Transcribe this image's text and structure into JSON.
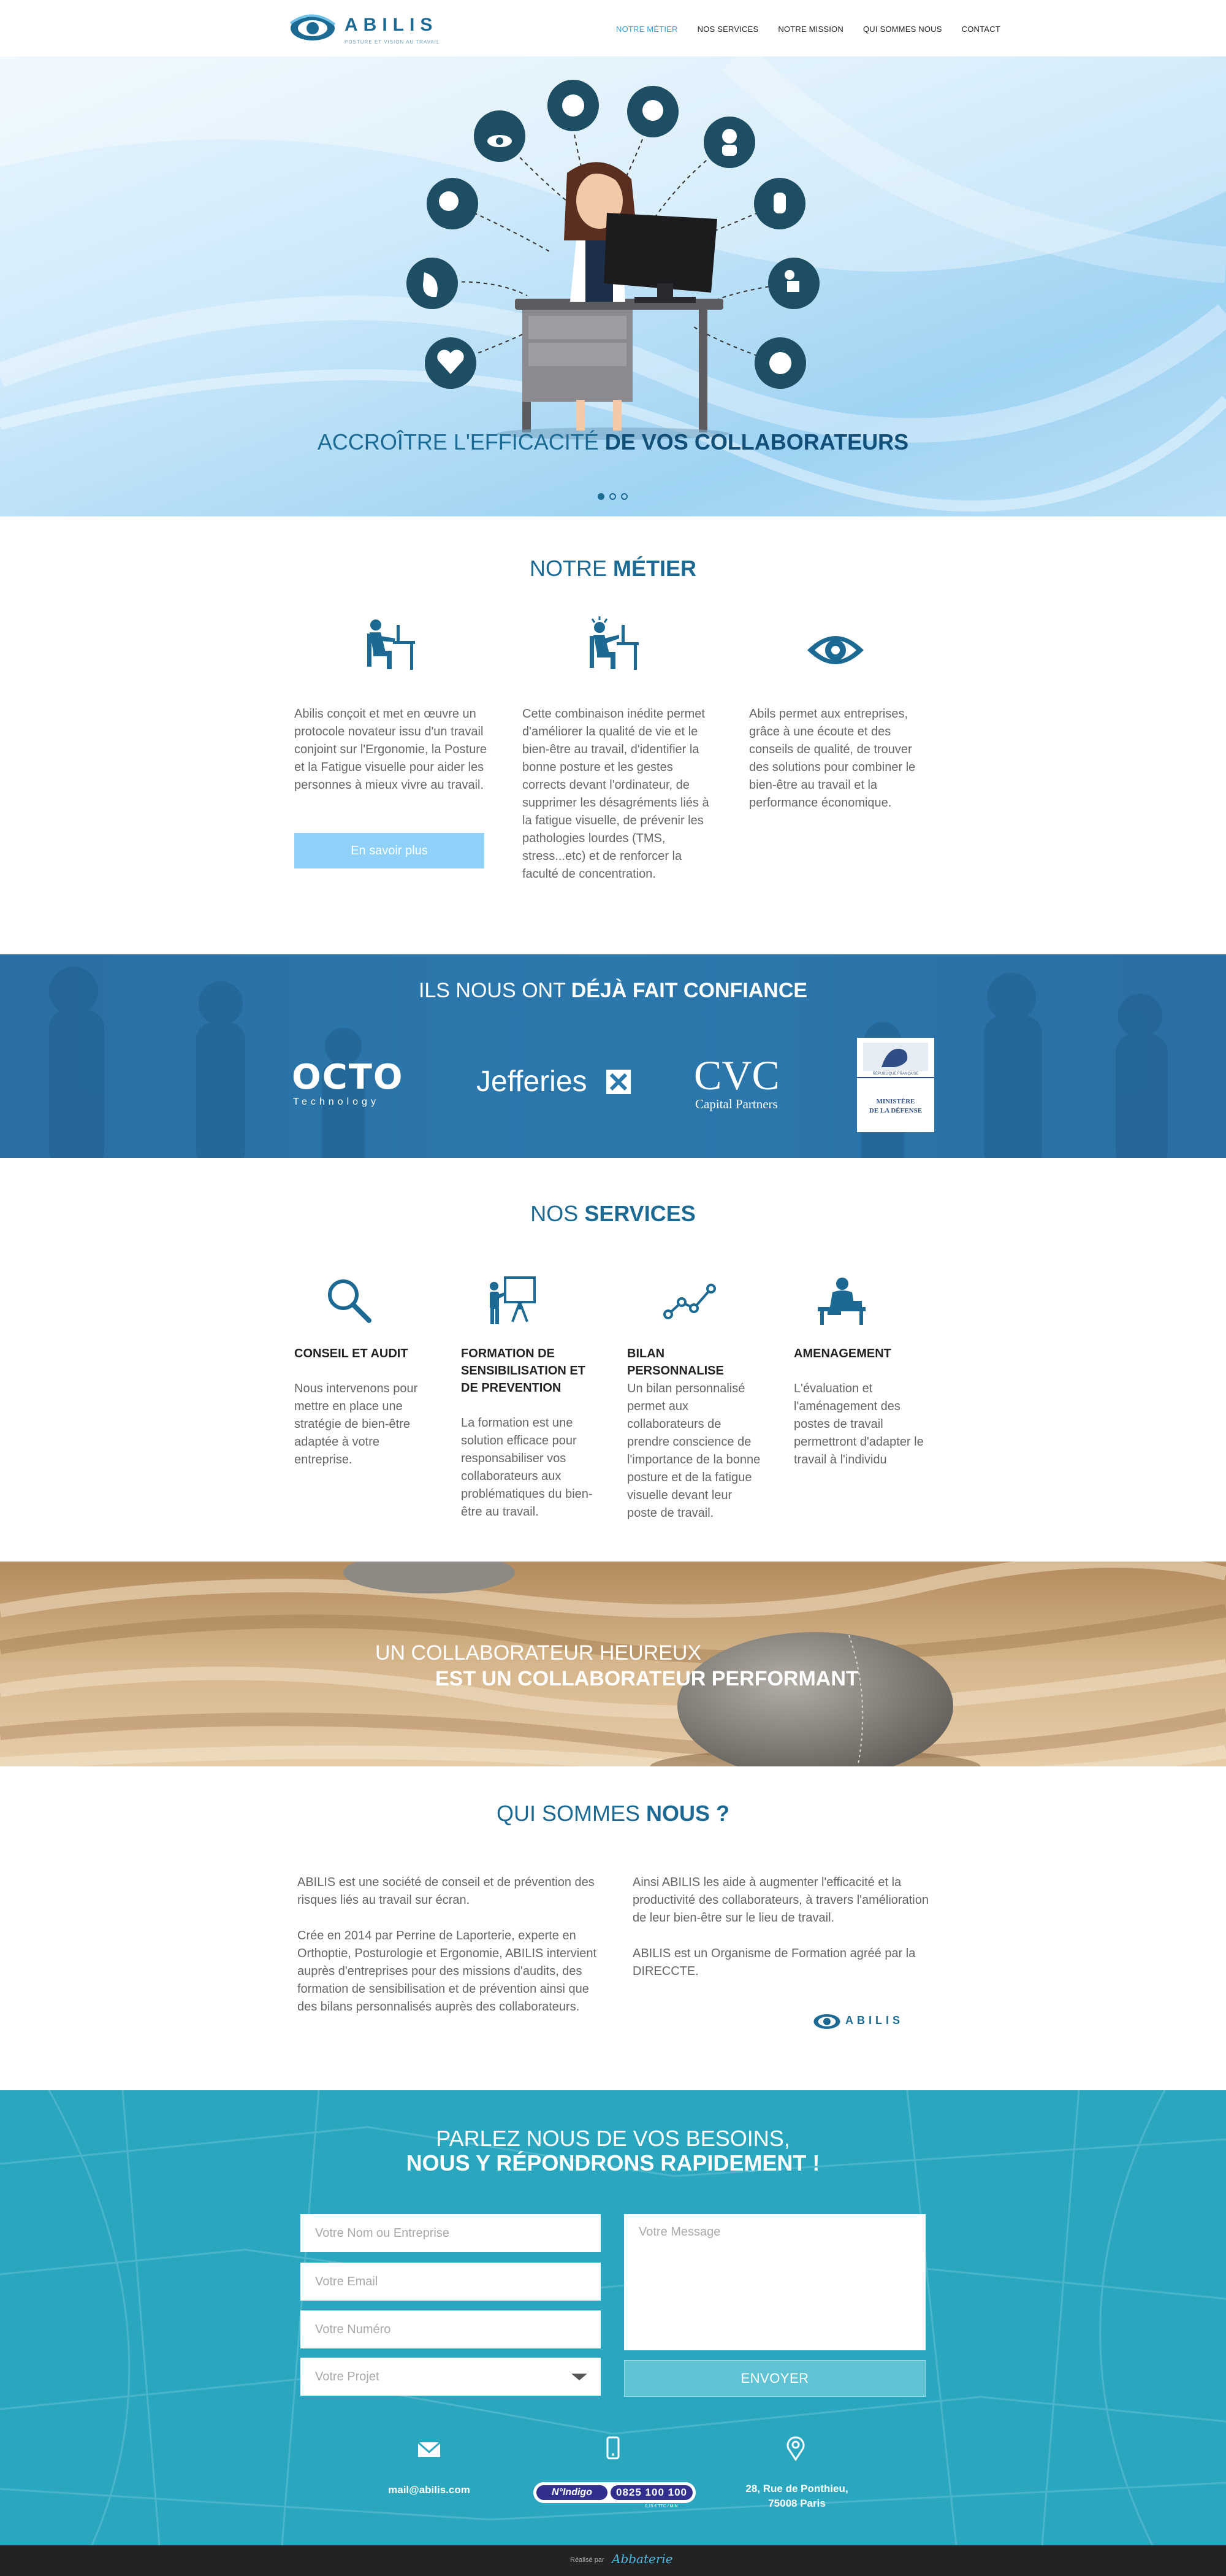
{
  "header": {
    "logo_text": "ABILIS",
    "logo_tagline": "POSTURE ET VISION AU TRAVAIL",
    "nav": [
      {
        "label": "NOTRE MÉTIER",
        "active": true
      },
      {
        "label": "NOS SERVICES",
        "active": false
      },
      {
        "label": "NOTRE MISSION",
        "active": false
      },
      {
        "label": "QUI SOMMES NOUS",
        "active": false
      },
      {
        "label": "CONTACT",
        "active": false
      }
    ]
  },
  "hero": {
    "title_light": "ACCROÎTRE L'EFFICACITÉ",
    "title_bold": "DE VOS COLLABORATEURS",
    "slides": 3,
    "active_slide": 1
  },
  "metier": {
    "title_light": "NOTRE",
    "title_bold": "MÉTIER",
    "columns": [
      {
        "icon": "office-worker-icon",
        "text": "Abilis conçoit et met en œuvre un protocole novateur issu d'un travail conjoint sur l'Ergonomie, la Posture et la Fatigue visuelle pour aider les personnes à mieux vivre au travail."
      },
      {
        "icon": "stressed-worker-icon",
        "text": "Cette combinaison inédite permet d'améliorer la qualité de vie et le bien-être au travail, d'identifier la bonne posture et les gestes corrects devant l'ordinateur, de supprimer les désagréments liés à la fatigue visuelle, de prévenir les pathologies lourdes (TMS, stress...etc) et de renforcer la faculté de concentration."
      },
      {
        "icon": "eye-icon",
        "text": "Abils permet aux entreprises, grâce à une écoute et des conseils de qualité, de trouver des solutions pour combiner le bien-être au travail et la performance économique."
      }
    ],
    "button": "En savoir plus"
  },
  "confiance": {
    "title_light": "ILS NOUS ONT",
    "title_bold": "DÉJÀ FAIT CONFIANCE",
    "logos": {
      "octo": {
        "name": "OCTO",
        "sub": "Technology"
      },
      "jefferies": {
        "name": "Jefferies"
      },
      "cvc": {
        "name": "CVC",
        "sub": "Capital Partners"
      },
      "ministere": {
        "line0": "RÉPUBLIQUE FRANÇAISE",
        "line1": "MINISTÈRE",
        "line2": "DE LA DÉFENSE"
      }
    }
  },
  "services": {
    "title_light": "NOS",
    "title_bold": "SERVICES",
    "items": [
      {
        "icon": "magnifier-icon",
        "heading": "CONSEIL ET AUDIT",
        "text": "Nous intervenons pour mettre en place une stratégie de bien-être adaptée à votre entreprise."
      },
      {
        "icon": "presentation-board-icon",
        "heading": "FORMATION DE SENSIBILISATION ET DE PREVENTION",
        "text": "La formation est une solution efficace pour responsabiliser vos collaborateurs aux problématiques du bien-être au travail."
      },
      {
        "icon": "line-graph-icon",
        "heading": "BILAN PERSONNALISE",
        "text": "Un bilan personnalisé permet aux collaborateurs de prendre conscience de l'importance de la bonne posture et de la fatigue visuelle devant leur poste de travail."
      },
      {
        "icon": "desk-worker-icon",
        "heading": "AMENAGEMENT",
        "text": "L'évaluation et l'aménagement des postes de travail permettront d'adapter le travail à l'individu"
      }
    ]
  },
  "banner": {
    "line1": "UN COLLABORATEUR HEUREUX",
    "line2": "EST UN COLLABORATEUR PERFORMANT"
  },
  "qui": {
    "title_light": "QUI SOMMES",
    "title_bold": "NOUS ?",
    "left": [
      "ABILIS est une société de conseil et de prévention des risques liés au travail sur écran.",
      "Crée en 2014 par Perrine de Laporterie, experte en Orthoptie, Posturologie et Ergonomie, ABILIS intervient auprès d'entreprises pour des missions d'audits, des formation de sensibilisation et de prévention ainsi que des bilans personnalisés auprès des collaborateurs."
    ],
    "right": [
      "Ainsi ABILIS les aide à augmenter l'efficacité et la productivité des collaborateurs, à travers l'amélioration de leur bien-être sur le lieu de travail.",
      "ABILIS est un Organisme de Formation agréé par la DIRECCTE."
    ],
    "logo_text": "ABILIS"
  },
  "contact": {
    "title1": "PARLEZ NOUS DE VOS BESOINS,",
    "title2": "NOUS Y RÉPONDRONS RAPIDEMENT !",
    "placeholders": {
      "name": "Votre Nom ou Entreprise",
      "email": "Votre Email",
      "phone": "Votre Numéro",
      "project": "Votre Projet",
      "message": "Votre Message"
    },
    "send": "ENVOYER",
    "email": "mail@abilis.com",
    "indigo_label": "N°Indigo",
    "indigo_number": "0825 100 100",
    "indigo_rate": "0,15 € TTC / MIN",
    "address_line1": "28, Rue de Ponthieu,",
    "address_line2": "75008 Paris"
  },
  "footer": {
    "text": "Réalisé par",
    "brand": "Abbaterie"
  },
  "colors": {
    "primary": "#1c6a93",
    "accent": "#2aa3d6",
    "button_light": "#8fd1f8",
    "contact_bg": "#2ba6bf",
    "confiance_bg": "#2b78ad",
    "footer_bg": "#232323"
  }
}
